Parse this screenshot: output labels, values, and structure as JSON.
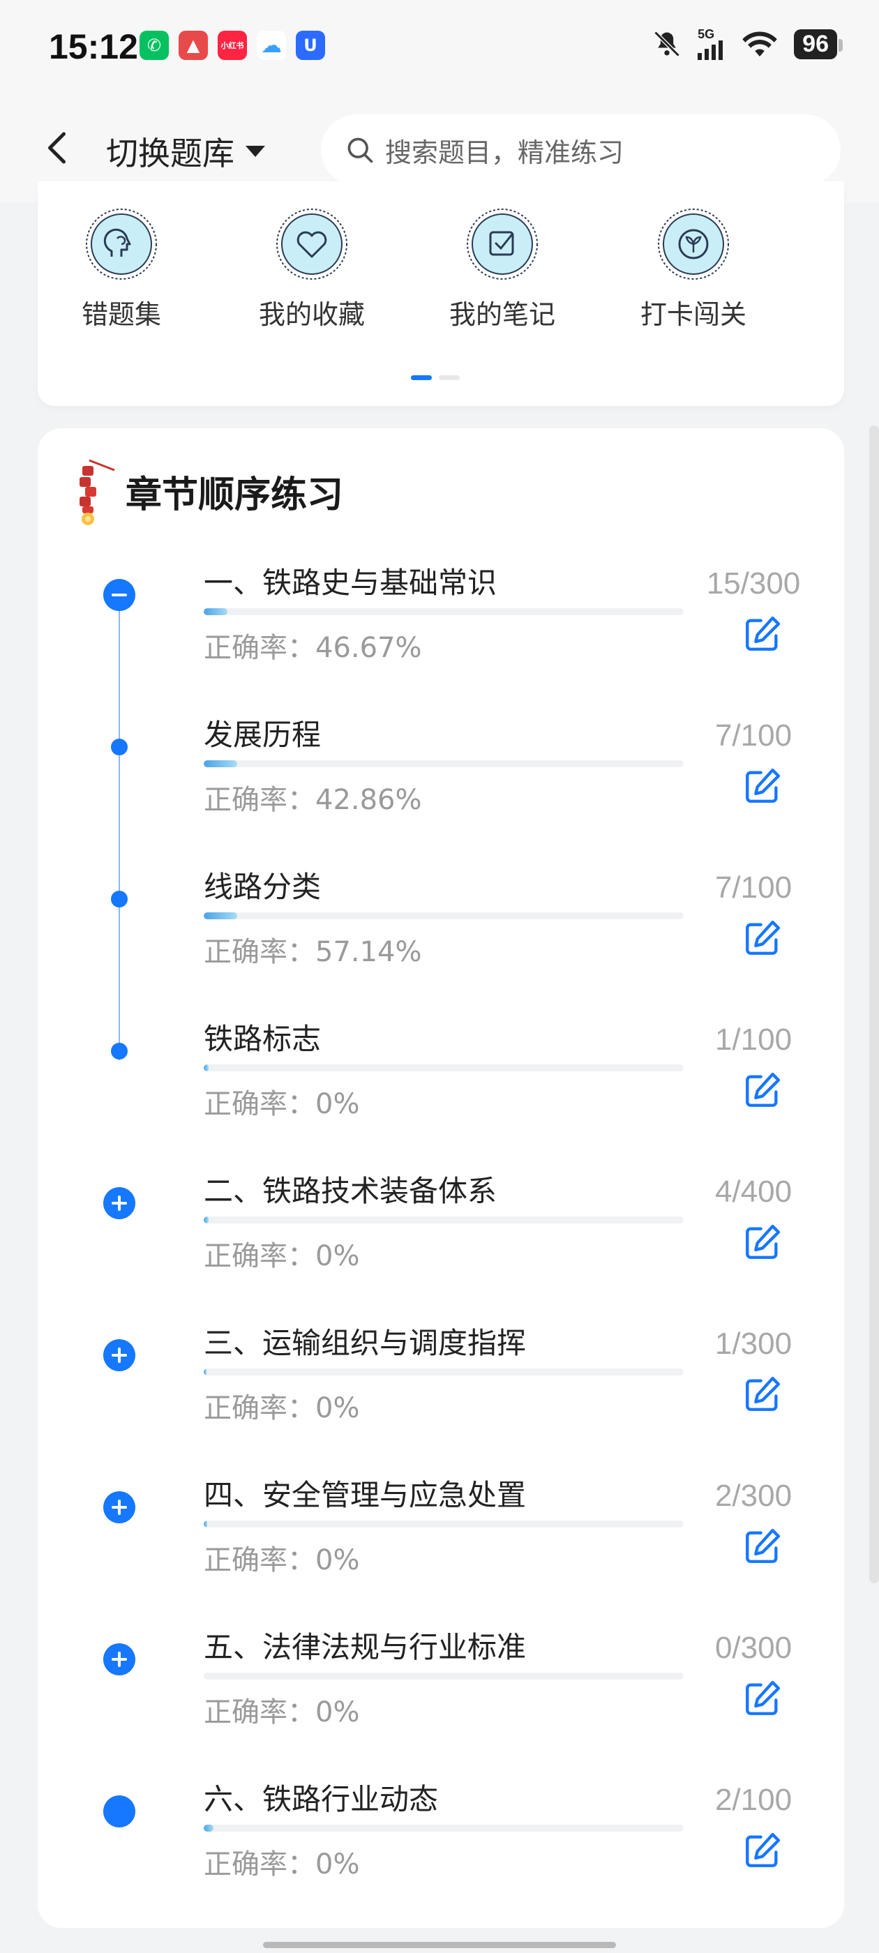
{
  "status_bar": {
    "time": "15:12",
    "signal": "5G",
    "battery": "96",
    "app_icons": [
      {
        "name": "wechat-icon",
        "color": "#07c160",
        "glyph": "✆"
      },
      {
        "name": "railway-app-icon",
        "color": "#e84a4a",
        "glyph": "▲"
      },
      {
        "name": "xiaohongshu-icon",
        "color": "#ff2442",
        "glyph": "小红书"
      },
      {
        "name": "cloud-icon",
        "color": "#ffffff",
        "glyph": "☁"
      },
      {
        "name": "tianyi-icon",
        "color": "#2b6bff",
        "glyph": "U"
      }
    ]
  },
  "header": {
    "switch_label": "切换题库",
    "search_placeholder": "搜索题目，精准练习"
  },
  "quick_menu": [
    {
      "label": "错题集",
      "icon": "brain-head-icon"
    },
    {
      "label": "我的收藏",
      "icon": "heart-icon"
    },
    {
      "label": "我的笔记",
      "icon": "note-check-icon"
    },
    {
      "label": "打卡闯关",
      "icon": "sprout-icon"
    }
  ],
  "chapter": {
    "title": "章节顺序练习",
    "rate_prefix": "正确率：",
    "rows": [
      {
        "title": "一、铁路史与基础常识",
        "rate": "46.67%",
        "count": "15/300",
        "progress": 0.05,
        "marker": "minus"
      },
      {
        "title": "发展历程",
        "rate": "42.86%",
        "count": "7/100",
        "progress": 0.07,
        "marker": "dot"
      },
      {
        "title": "线路分类",
        "rate": "57.14%",
        "count": "7/100",
        "progress": 0.07,
        "marker": "dot"
      },
      {
        "title": "铁路标志",
        "rate": "0%",
        "count": "1/100",
        "progress": 0.01,
        "marker": "dot"
      },
      {
        "title": "二、铁路技术装备体系",
        "rate": "0%",
        "count": "4/400",
        "progress": 0.01,
        "marker": "plus"
      },
      {
        "title": "三、运输组织与调度指挥",
        "rate": "0%",
        "count": "1/300",
        "progress": 0.003,
        "marker": "plus"
      },
      {
        "title": "四、安全管理与应急处置",
        "rate": "0%",
        "count": "2/300",
        "progress": 0.007,
        "marker": "plus"
      },
      {
        "title": "五、法律法规与行业标准",
        "rate": "0%",
        "count": "0/300",
        "progress": 0,
        "marker": "plus"
      },
      {
        "title": "六、铁路行业动态",
        "rate": "0%",
        "count": "2/100",
        "progress": 0.02,
        "marker": "filled"
      }
    ]
  },
  "colors": {
    "accent": "#1677ff",
    "progress_start": "#4aa3e8",
    "progress_end": "#a6dcf4",
    "muted": "#a8a8a8"
  }
}
